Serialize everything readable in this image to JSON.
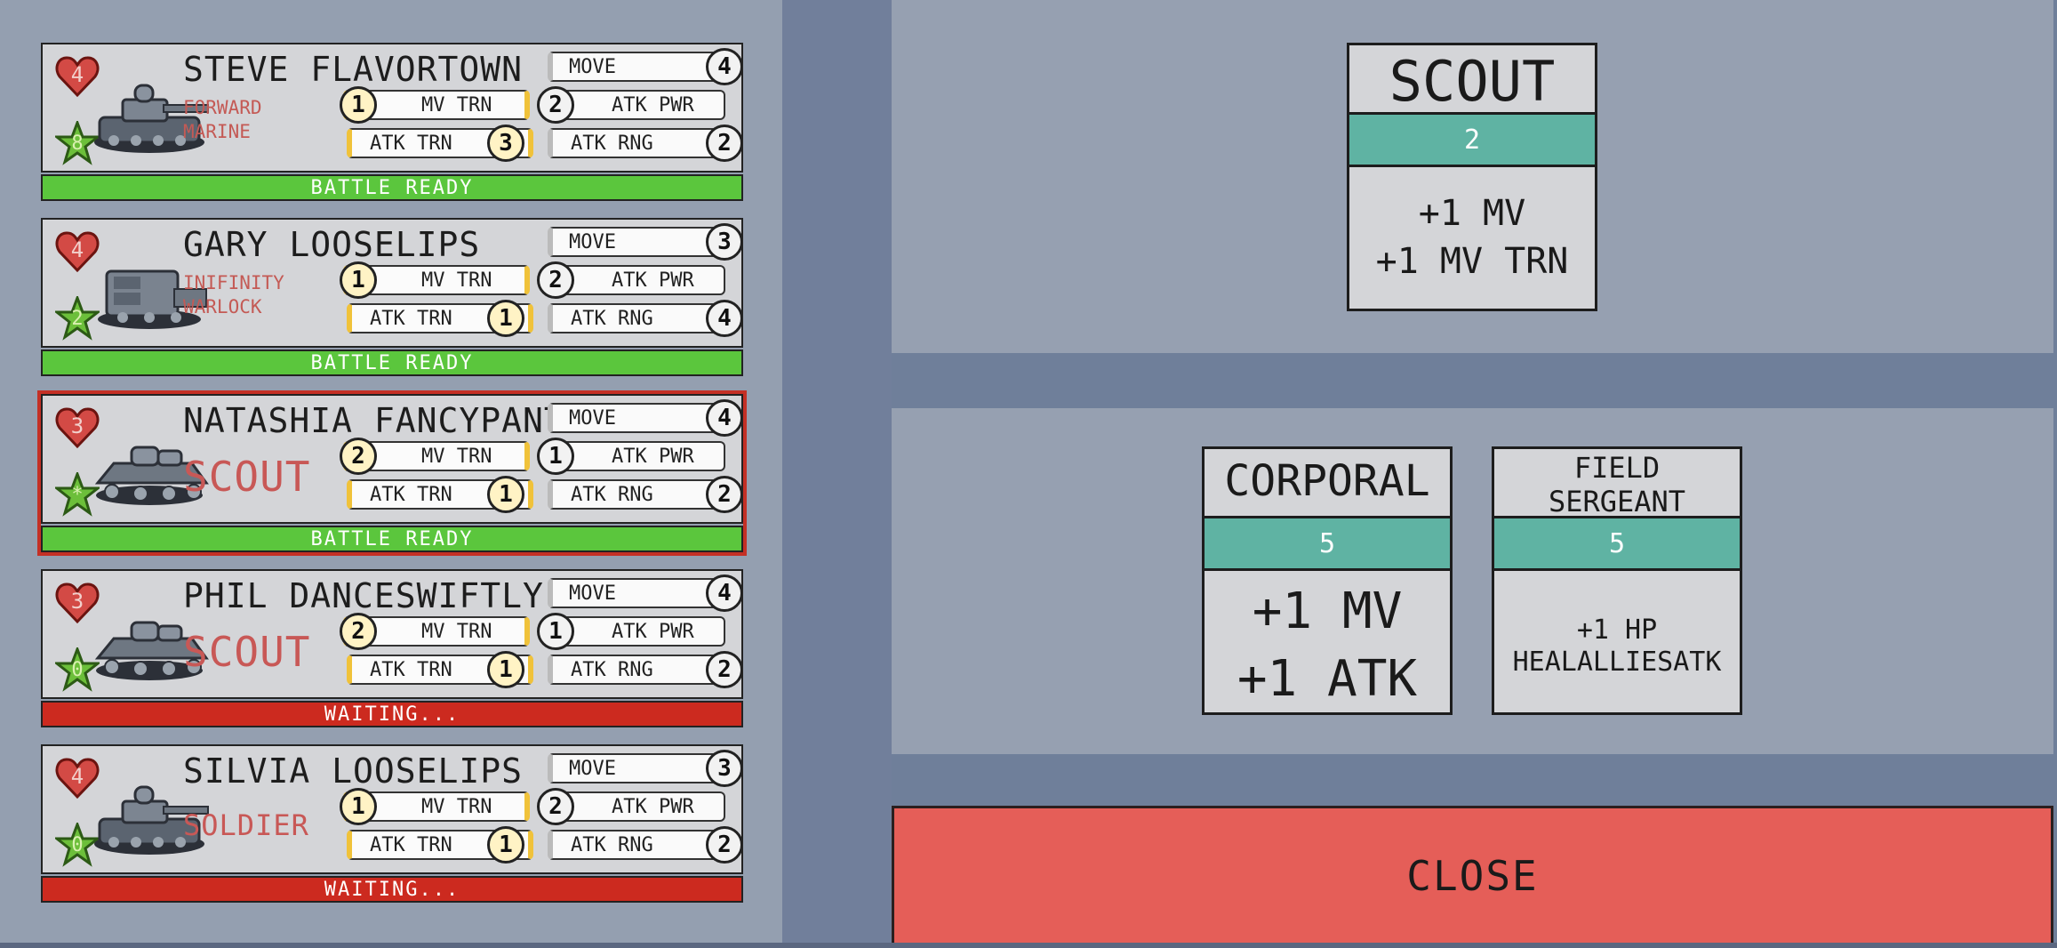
{
  "units": [
    {
      "name": "STEVE FLAVORTOWN",
      "rank": "FORWARD MARINE",
      "hp": "4",
      "xp": "8",
      "move": "4",
      "mv_trn": "1",
      "atk_trn": "3",
      "atk_pwr": "2",
      "atk_rng": "2",
      "status": "BATTLE READY",
      "status_type": "ready",
      "selected": false
    },
    {
      "name": "GARY LOOSELIPS",
      "rank": "INIFINITY WARLOCK",
      "hp": "4",
      "xp": "2",
      "move": "3",
      "mv_trn": "1",
      "atk_trn": "1",
      "atk_pwr": "2",
      "atk_rng": "4",
      "status": "BATTLE READY",
      "status_type": "ready",
      "selected": false
    },
    {
      "name": "NATASHIA FANCYPANTS",
      "rank": "SCOUT",
      "hp": "3",
      "xp": "*",
      "move": "4",
      "mv_trn": "2",
      "atk_trn": "1",
      "atk_pwr": "1",
      "atk_rng": "2",
      "status": "BATTLE READY",
      "status_type": "ready",
      "selected": true
    },
    {
      "name": "PHIL DANCESWIFTLY",
      "rank": "SCOUT",
      "hp": "3",
      "xp": "0",
      "move": "4",
      "mv_trn": "2",
      "atk_trn": "1",
      "atk_pwr": "1",
      "atk_rng": "2",
      "status": "WAITING...",
      "status_type": "waiting",
      "selected": false
    },
    {
      "name": "SILVIA LOOSELIPS",
      "rank": "SOLDIER",
      "hp": "4",
      "xp": "0",
      "move": "3",
      "mv_trn": "1",
      "atk_trn": "1",
      "atk_pwr": "2",
      "atk_rng": "2",
      "status": "WAITING...",
      "status_type": "waiting",
      "selected": false
    }
  ],
  "labels": {
    "move": "MOVE",
    "mv_trn": "MV TRN",
    "atk_trn": "ATK TRN",
    "atk_pwr": "ATK PWR",
    "atk_rng": "ATK RNG"
  },
  "current_rank": {
    "title": "SCOUT",
    "cost": "2",
    "bonus_line1": "+1 MV",
    "bonus_line2": "+1 MV TRN"
  },
  "promotions": [
    {
      "title": "CORPORAL",
      "cost": "5",
      "bonus_line1": "+1 MV",
      "bonus_line2": "+1 ATK"
    },
    {
      "title_line1": "FIELD",
      "title_line2": "SERGEANT",
      "cost": "5",
      "bonus_line1": "+1 HP",
      "bonus_line2": "HEALALLIESATK"
    }
  ],
  "close_label": "CLOSE",
  "colors": {
    "ready": "#5bc63d",
    "waiting": "#cc2a1f",
    "selected_border": "#c43025",
    "cost_band": "#5fb3a3",
    "close": "#e55e58",
    "rank_text": "#c85856"
  }
}
